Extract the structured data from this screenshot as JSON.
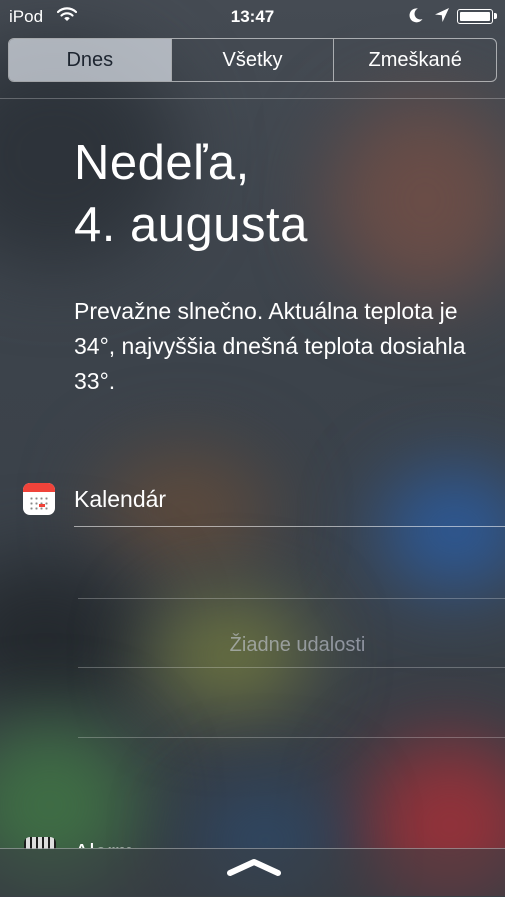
{
  "status_bar": {
    "carrier": "iPod",
    "time": "13:47",
    "wifi_icon": "wifi-icon",
    "moon_icon": "do-not-disturb-moon-icon",
    "location_icon": "location-arrow-icon",
    "battery_level": 1.0
  },
  "segments": {
    "items": [
      "Dnes",
      "Všetky",
      "Zmeškané"
    ],
    "selected": "Dnes"
  },
  "today": {
    "date_line1": "Nedeľa,",
    "date_line2": "4. augusta",
    "weather_summary": "Prevažne slnečno. Aktuálna teplota je 34°, najvyššia dnešná teplota dosiahla 33°."
  },
  "calendar": {
    "icon": "calendar-app-icon",
    "title": "Kalendár",
    "empty_message": "Žiadne udalosti"
  },
  "alarm": {
    "icon": "alarm-clock-icon",
    "title": "Alarm"
  },
  "colors": {
    "segment_selected_bg": "#dce2ea",
    "calendar_red": "#f0433a",
    "text": "#ffffff"
  }
}
